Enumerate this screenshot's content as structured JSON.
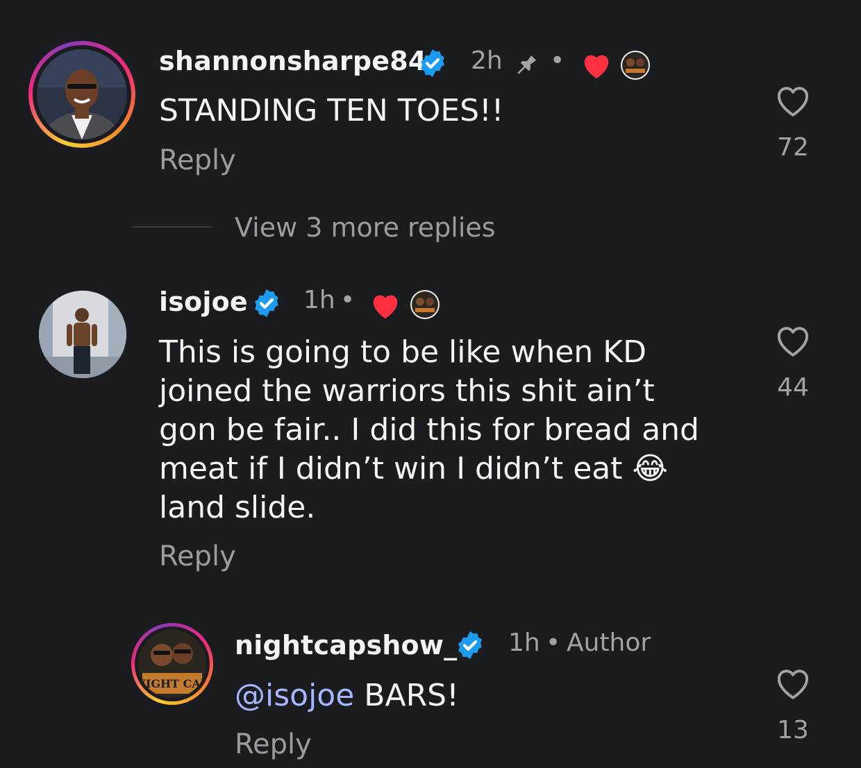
{
  "comments": [
    {
      "username": "shannonsharpe84",
      "time": "2h",
      "text": "STANDING TEN TOES!!",
      "reply_label": "Reply",
      "likes": "72",
      "pinned": true,
      "liked_by_author": true
    },
    {
      "username": "isojoe",
      "time": "1h",
      "text": "This is going to be like when KD joined the warriors this shit ain’t gon be fair.. I did this for bread and meat if I didn’t win I didn’t eat 😂 land slide.",
      "reply_label": "Reply",
      "likes": "44",
      "liked_by_author": true
    }
  ],
  "view_more_replies": "View 3 more replies",
  "reply": {
    "username": "nightcapshow_",
    "time": "1h",
    "author_label": "Author",
    "mention": "@isojoe",
    "text": "BARS!",
    "reply_label": "Reply",
    "likes": "13",
    "avatar_logo_text": "NIGHT CAP"
  },
  "separator_dot": "•",
  "colors": {
    "background": "#1b1c20",
    "verified": "#1d9bf0",
    "heart": "#ff3040",
    "mention": "#a9b6ff"
  },
  "icons": {
    "verified": "verified-badge-icon",
    "pin": "pin-icon",
    "heart_red": "liked-by-author-heart-icon",
    "like": "like-heart-outline-icon"
  }
}
